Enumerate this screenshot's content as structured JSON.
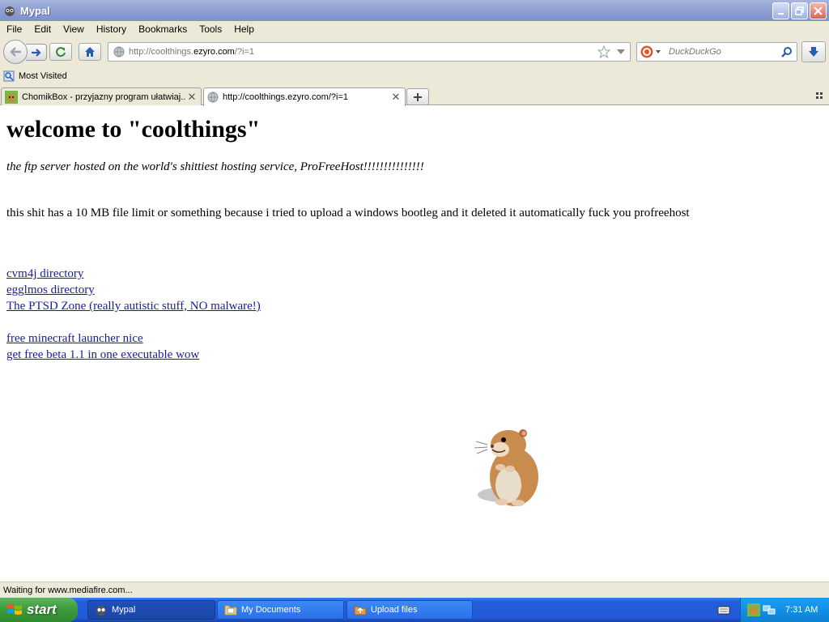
{
  "window": {
    "title": "Mypal"
  },
  "menu": [
    {
      "label": "File"
    },
    {
      "label": "Edit"
    },
    {
      "label": "View"
    },
    {
      "label": "History"
    },
    {
      "label": "Bookmarks"
    },
    {
      "label": "Tools"
    },
    {
      "label": "Help"
    }
  ],
  "nav": {
    "url_prefix": "http://coolthings.",
    "url_domain": "ezyro.com",
    "url_suffix": "/?i=1",
    "search_placeholder": "DuckDuckGo"
  },
  "bookmarks": {
    "most_visited": "Most Visited"
  },
  "tabs": [
    {
      "label": "ChomikBox - przyjazny program ułatwiaj...",
      "active": false
    },
    {
      "label": "http://coolthings.ezyro.com/?i=1",
      "active": true
    }
  ],
  "page": {
    "heading": "welcome to \"coolthings\"",
    "subtitle": "the ftp server hosted on the world's shittiest hosting service, ProFreeHost!!!!!!!!!!!!!!!",
    "paragraph": "this shit has a 10 MB file limit or something because i tried to upload a windows bootleg and it deleted it automatically fuck you profreehost",
    "links": [
      {
        "label": "cvm4j directory"
      },
      {
        "label": "egglmos directory"
      },
      {
        "label": "The PTSD Zone (really autistic stuff, NO malware!)"
      },
      {
        "label": "free minecraft launcher nice"
      },
      {
        "label": "get free beta 1.1 in one executable wow"
      }
    ]
  },
  "status": {
    "text": "Waiting for www.mediafire.com..."
  },
  "taskbar": {
    "start_label": "start",
    "items": [
      {
        "label": "Mypal",
        "active": true
      },
      {
        "label": "My Documents",
        "active": false
      },
      {
        "label": "Upload files",
        "active": false
      }
    ],
    "clock": "7:31 AM"
  }
}
